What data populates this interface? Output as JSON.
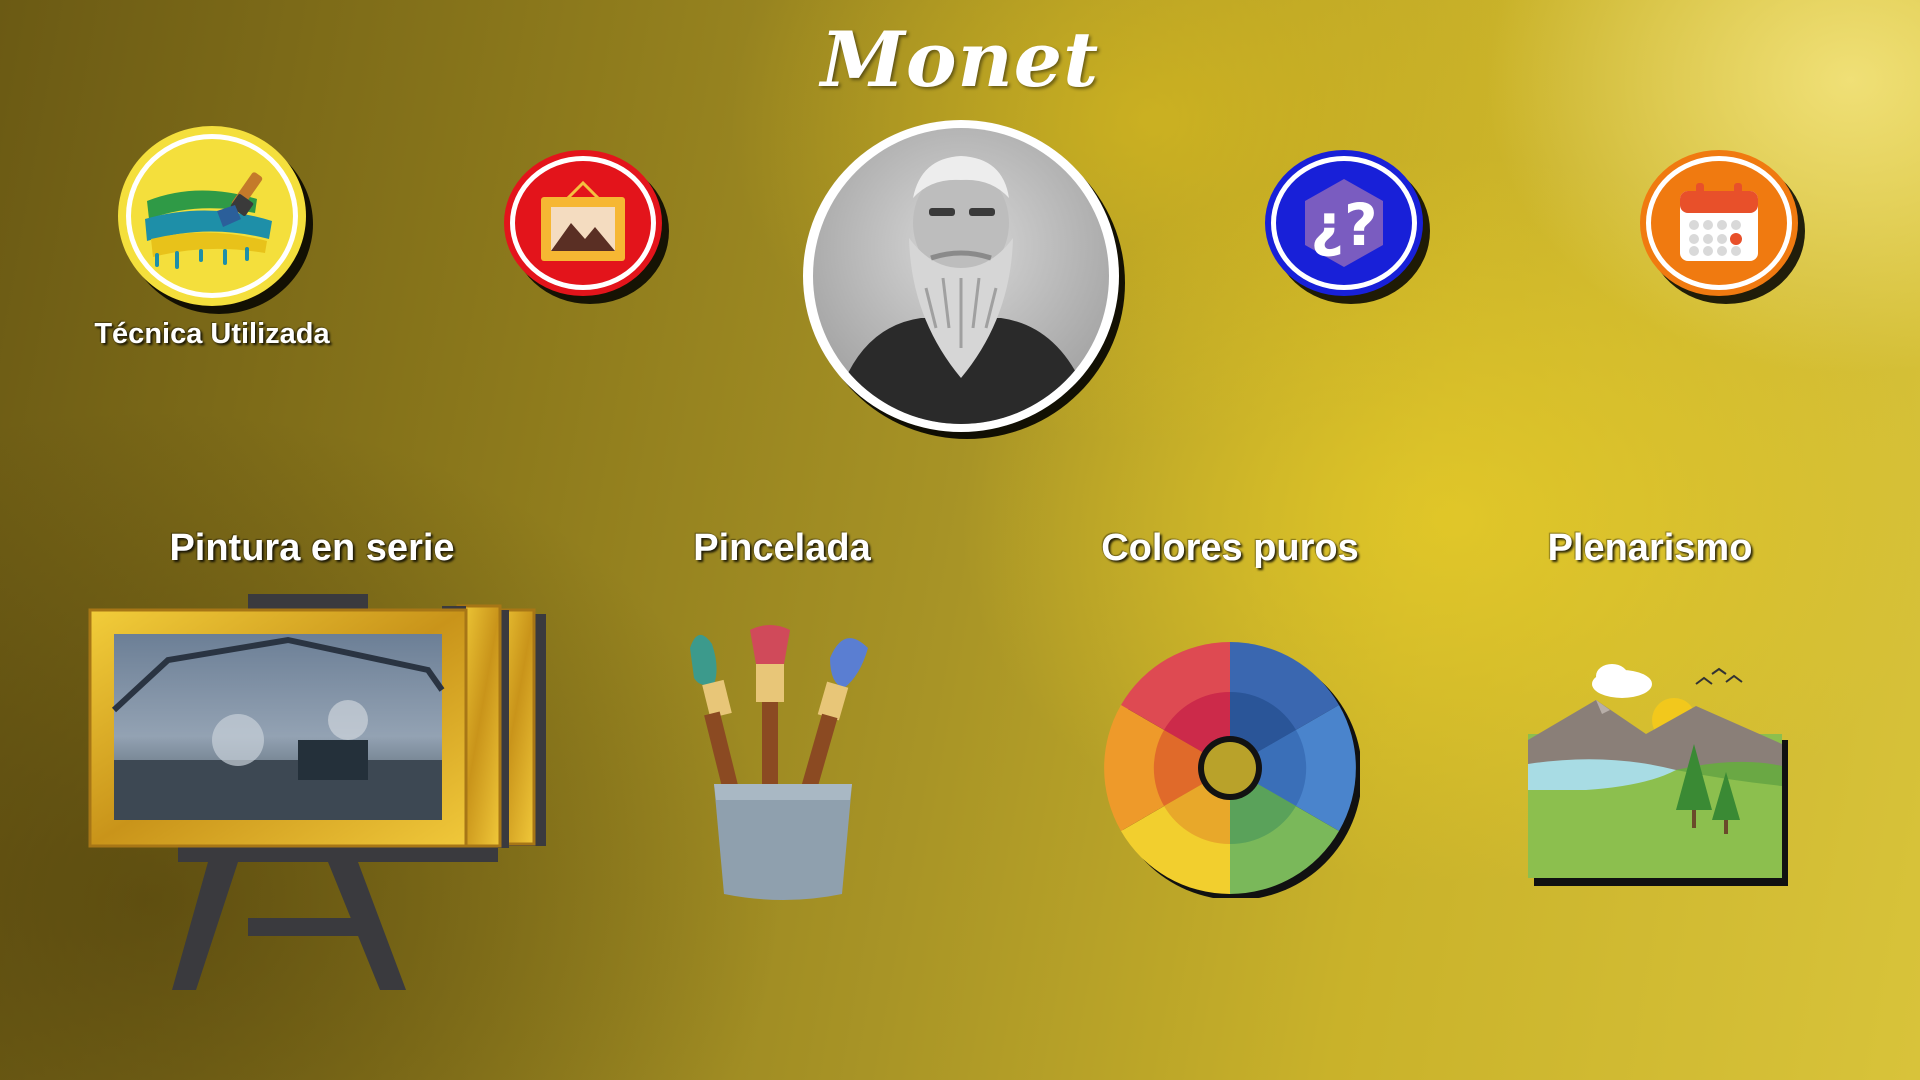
{
  "header": {
    "title": "Monet"
  },
  "top_buttons": {
    "tecnica_label": "Técnica Utilizada"
  },
  "categories": [
    {
      "label": "Pintura en serie",
      "icon": "easel-icon"
    },
    {
      "label": "Pincelada",
      "icon": "paintbrushes-icon"
    },
    {
      "label": "Colores  puros",
      "icon": "color-wheel-icon"
    },
    {
      "label": "Plenarismo",
      "icon": "landscape-icon"
    }
  ],
  "colors": {
    "tecnica_yellow": "#f4df3c",
    "obras_red": "#e3141b",
    "info_blue": "#1820d8",
    "calendar_orange": "#f07a10",
    "frame_gold": "#d6a824"
  }
}
